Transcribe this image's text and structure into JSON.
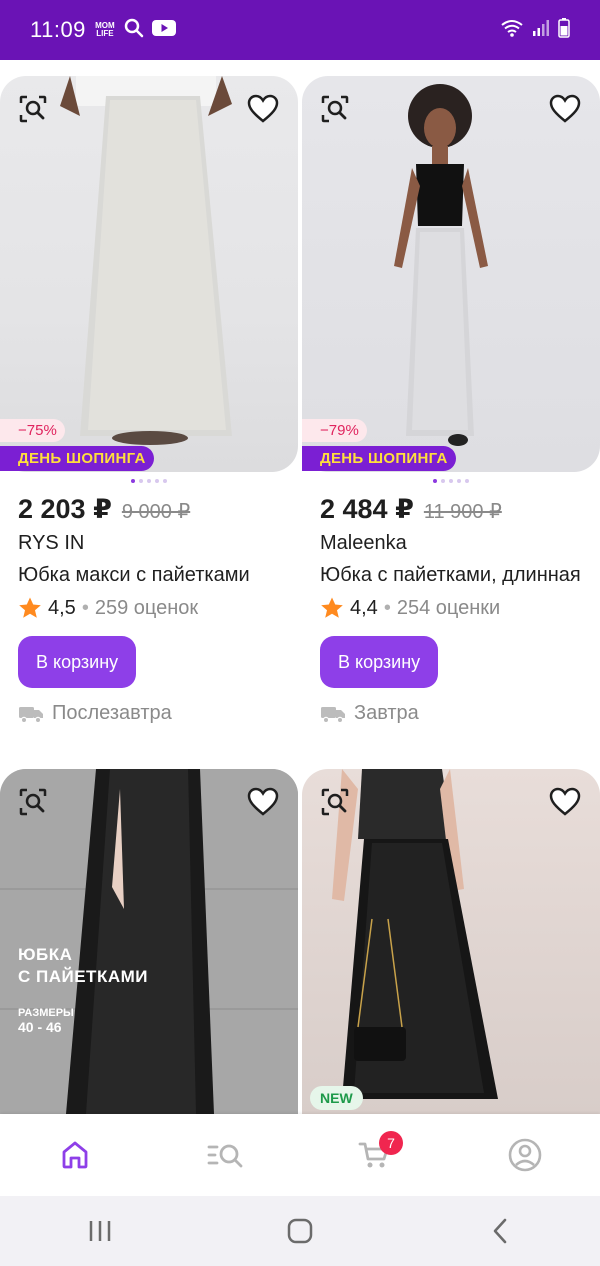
{
  "status_bar": {
    "time": "11:09",
    "badge_text_top": "MOM",
    "badge_text_bottom": "LIFE",
    "icons": [
      "mom-life-badge",
      "search-icon",
      "youtube-icon",
      "wifi-icon",
      "signal-icon",
      "battery-icon"
    ]
  },
  "colors": {
    "brand": "#6a13b5",
    "accent": "#8e3fe8",
    "promo_bg": "#7b1fd3",
    "promo_text": "#ffdf3c",
    "discount_text": "#e0245e",
    "new_text": "#1d9a4a",
    "cart_badge": "#f0264f"
  },
  "products": [
    {
      "discount": "−75%",
      "promo": "ДЕНЬ ШОПИНГА",
      "price": "2 203 ₽",
      "old_price": "9 000 ₽",
      "brand": "RYS IN",
      "title": "Юбка макси с пайетками",
      "rating": "4,5",
      "reviews": "259 оценок",
      "cart_button": "В корзину",
      "delivery": "Послезавтра"
    },
    {
      "discount": "−79%",
      "promo": "ДЕНЬ ШОПИНГА",
      "price": "2 484 ₽",
      "old_price": "11 900 ₽",
      "brand": "Maleenka",
      "title": "Юбка с пайетками, длинная",
      "rating": "4,4",
      "reviews": "254 оценки",
      "cart_button": "В корзину",
      "delivery": "Завтра"
    },
    {
      "image_text_line1": "ЮБКА",
      "image_text_line2": "С ПАЙЕТКАМИ",
      "image_sizes_label": "РАЗМЕРЫ",
      "image_sizes_value": "40 - 46"
    },
    {
      "badge": "NEW"
    }
  ],
  "bottom_nav": {
    "items": [
      "home-icon",
      "catalog-icon",
      "cart-icon",
      "profile-icon"
    ],
    "cart_count": "7"
  }
}
